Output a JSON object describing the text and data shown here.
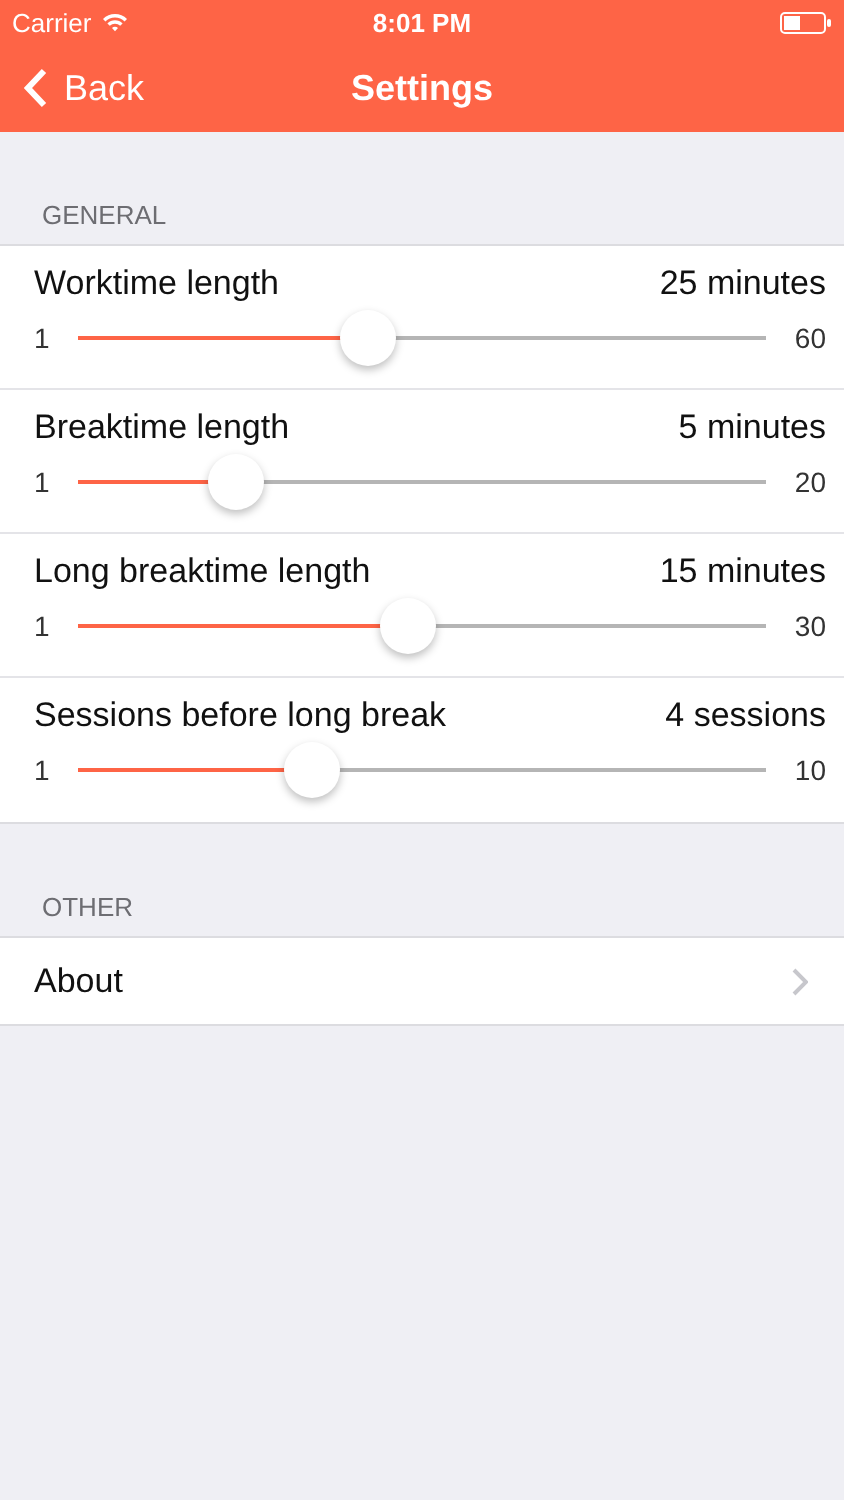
{
  "status_bar": {
    "carrier": "Carrier",
    "time": "8:01 PM"
  },
  "nav": {
    "back": "Back",
    "title": "Settings"
  },
  "sections": [
    {
      "header": "GENERAL",
      "rows": [
        {
          "kind": "slider",
          "label": "Worktime length",
          "value": "25 minutes",
          "min": "1",
          "max": "60",
          "level": 0.42
        },
        {
          "kind": "slider",
          "label": "Breaktime length",
          "value": "5 minutes",
          "min": "1",
          "max": "20",
          "level": 0.23
        },
        {
          "kind": "slider",
          "label": "Long breaktime length",
          "value": "15 minutes",
          "min": "1",
          "max": "30",
          "level": 0.48
        },
        {
          "kind": "slider",
          "label": "Sessions before long break",
          "value": "4 sessions",
          "min": "1",
          "max": "10",
          "level": 0.34
        }
      ]
    },
    {
      "header": "OTHER",
      "rows": [
        {
          "kind": "link",
          "label": "About"
        }
      ]
    }
  ]
}
